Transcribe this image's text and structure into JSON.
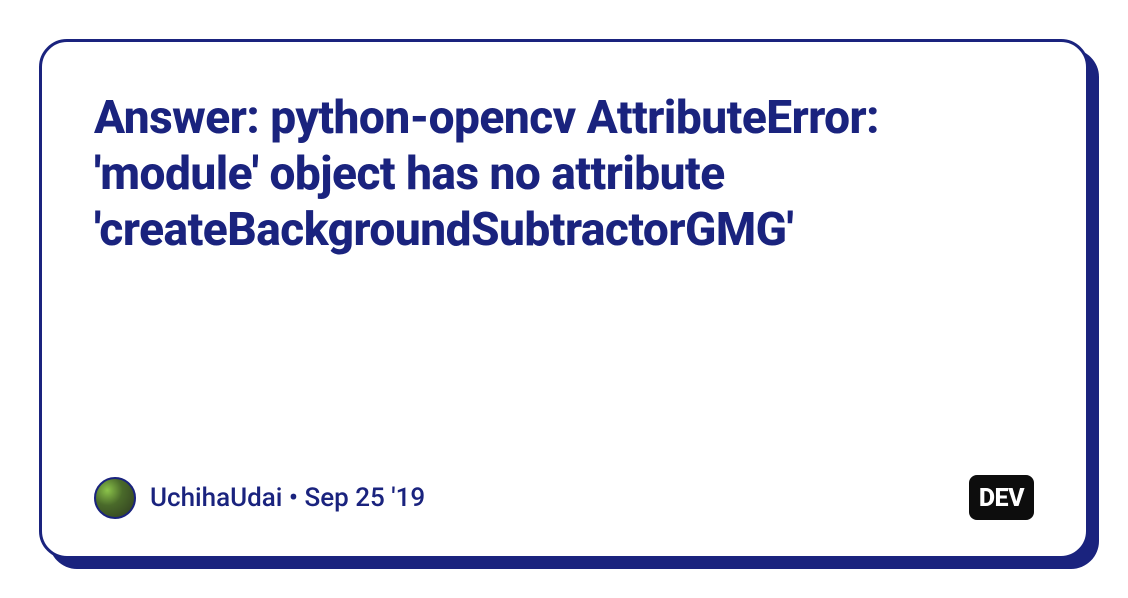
{
  "title": "Answer: python-opencv AttributeError: 'module' object has no attribute 'createBackgroundSubtractorGMG'",
  "author": {
    "name": "UchihaUdai",
    "date": "Sep 25 '19"
  },
  "badge": "DEV",
  "separator": " • "
}
